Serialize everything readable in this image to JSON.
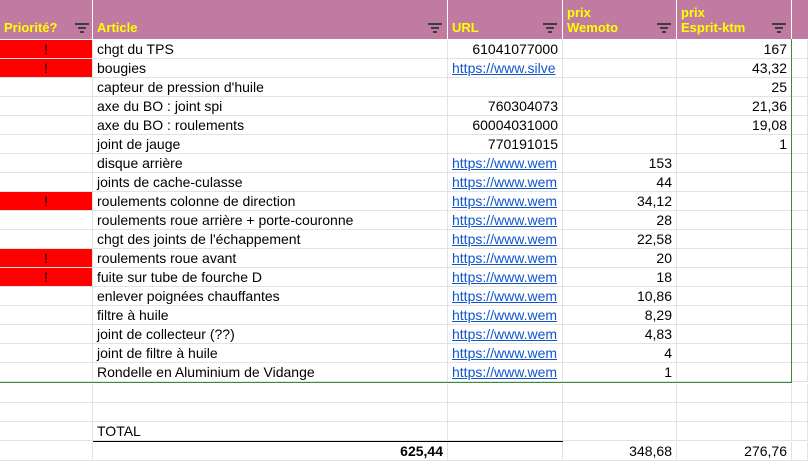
{
  "headers": {
    "priority": "Priorité?",
    "article": "Article",
    "url": "URL",
    "wemoto": "prix\nWemoto",
    "esprit": "prix\nEsprit-ktm"
  },
  "rows": [
    {
      "priority": "!",
      "article": "chgt du TPS",
      "url": "61041077000",
      "url_is_link": false,
      "wemoto": "",
      "esprit": "167"
    },
    {
      "priority": "!",
      "article": "bougies",
      "url": "https://www.silve",
      "url_is_link": true,
      "wemoto": "",
      "esprit": "43,32"
    },
    {
      "priority": "",
      "article": "capteur de pression d'huile",
      "url": "",
      "url_is_link": false,
      "wemoto": "",
      "esprit": "25"
    },
    {
      "priority": "",
      "article": "axe du BO : joint spi",
      "url": "760304073",
      "url_is_link": false,
      "wemoto": "",
      "esprit": "21,36"
    },
    {
      "priority": "",
      "article": "axe du BO : roulements",
      "url": "60004031000",
      "url_is_link": false,
      "wemoto": "",
      "esprit": "19,08"
    },
    {
      "priority": "",
      "article": "joint de jauge",
      "url": "770191015",
      "url_is_link": false,
      "wemoto": "",
      "esprit": "1"
    },
    {
      "priority": "",
      "article": "disque arrière",
      "url": "https://www.wem",
      "url_is_link": true,
      "wemoto": "153",
      "esprit": ""
    },
    {
      "priority": "",
      "article": "joints de cache-culasse",
      "url": "https://www.wem",
      "url_is_link": true,
      "wemoto": "44",
      "esprit": ""
    },
    {
      "priority": "!",
      "article": "roulements colonne de direction",
      "url": "https://www.wem",
      "url_is_link": true,
      "wemoto": "34,12",
      "esprit": ""
    },
    {
      "priority": "",
      "article": "roulements roue arrière + porte-couronne",
      "url": "https://www.wem",
      "url_is_link": true,
      "wemoto": "28",
      "esprit": ""
    },
    {
      "priority": "",
      "article": "chgt des joints de l'échappement",
      "url": "https://www.wem",
      "url_is_link": true,
      "wemoto": "22,58",
      "esprit": ""
    },
    {
      "priority": "!",
      "article": "roulements roue avant",
      "url": "https://www.wem",
      "url_is_link": true,
      "wemoto": "20",
      "esprit": ""
    },
    {
      "priority": "!",
      "article": "fuite sur tube de fourche D",
      "url": "https://www.wem",
      "url_is_link": true,
      "wemoto": "18",
      "esprit": ""
    },
    {
      "priority": "",
      "article": "enlever poignées chauffantes",
      "url": "https://www.wem",
      "url_is_link": true,
      "wemoto": "10,86",
      "esprit": ""
    },
    {
      "priority": "",
      "article": "filtre à huile",
      "url": "https://www.wem",
      "url_is_link": true,
      "wemoto": "8,29",
      "esprit": ""
    },
    {
      "priority": "",
      "article": "joint de collecteur (??)",
      "url": "https://www.wem",
      "url_is_link": true,
      "wemoto": "4,83",
      "esprit": ""
    },
    {
      "priority": "",
      "article": "joint de filtre à huile",
      "url": "https://www.wem",
      "url_is_link": true,
      "wemoto": "4",
      "esprit": ""
    },
    {
      "priority": "",
      "article": "Rondelle en Aluminium de Vidange",
      "url": "https://www.wem",
      "url_is_link": true,
      "wemoto": "1",
      "esprit": ""
    }
  ],
  "total": {
    "label": "TOTAL",
    "grand_total": "625,44",
    "wemoto_total": "348,68",
    "esprit_total": "276,76"
  },
  "colors": {
    "header_bg": "#c27ba0",
    "header_text": "#ffff00",
    "priority_flag": "#ff0000",
    "link": "#1155cc",
    "table_border": "#3c8a3c"
  }
}
